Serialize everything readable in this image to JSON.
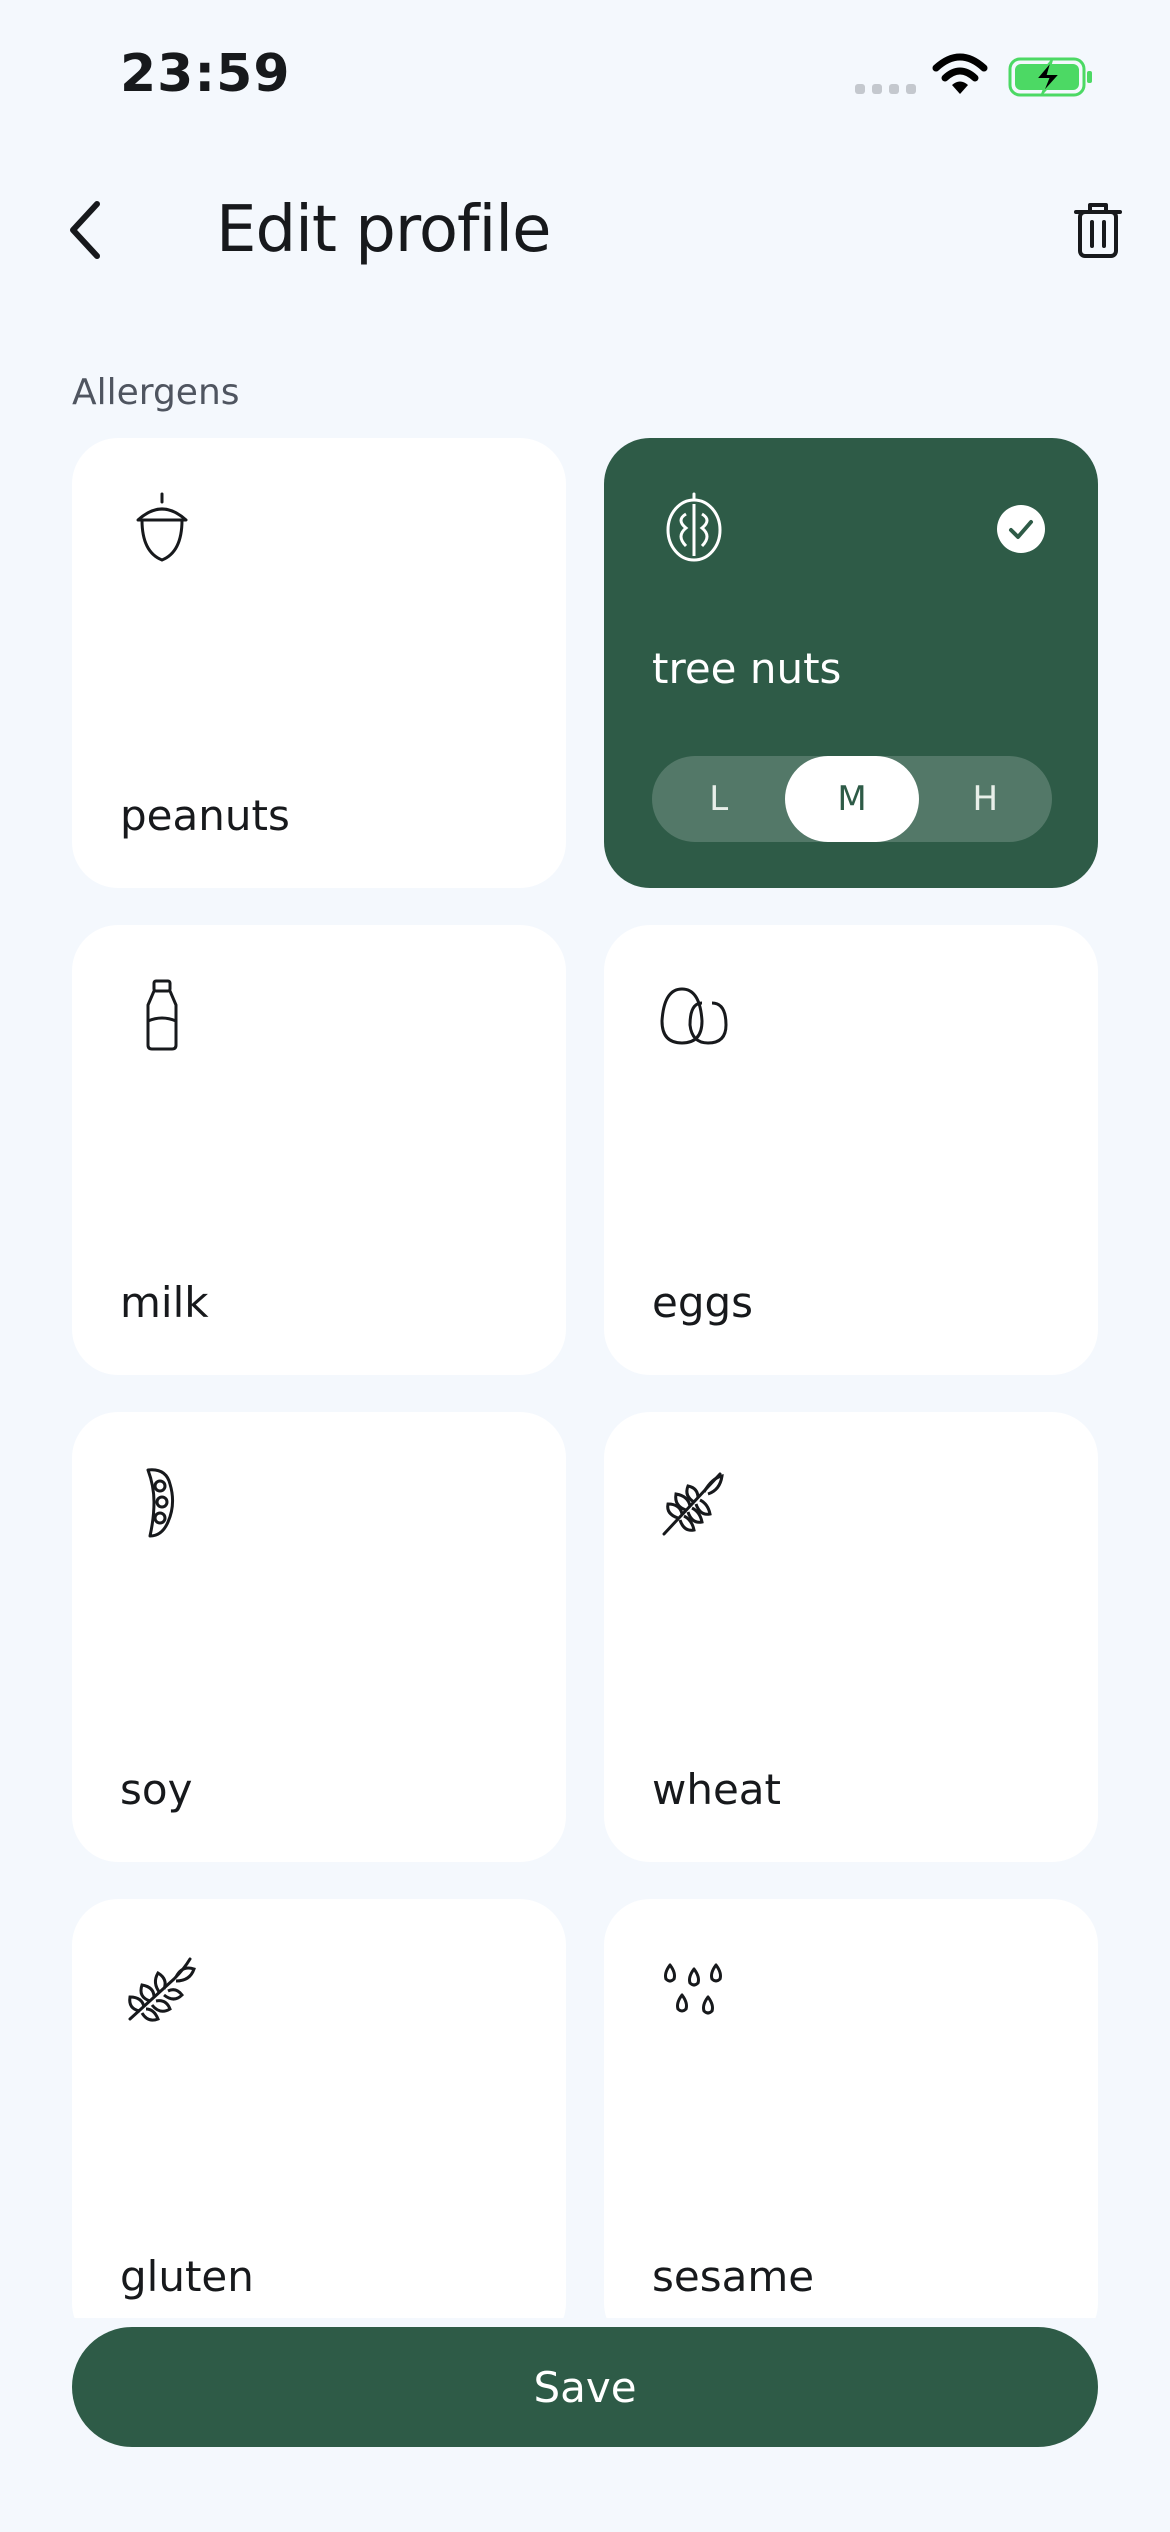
{
  "status_bar": {
    "time": "23:59"
  },
  "header": {
    "title": "Edit profile"
  },
  "section": {
    "label": "Allergens"
  },
  "allergens": [
    {
      "label": "peanuts",
      "icon": "acorn-icon",
      "selected": false
    },
    {
      "label": "tree nuts",
      "icon": "walnut-icon",
      "selected": true,
      "severity": "M"
    },
    {
      "label": "milk",
      "icon": "milk-bottle-icon",
      "selected": false
    },
    {
      "label": "eggs",
      "icon": "eggs-icon",
      "selected": false
    },
    {
      "label": "soy",
      "icon": "soybean-icon",
      "selected": false
    },
    {
      "label": "wheat",
      "icon": "wheat-icon",
      "selected": false
    },
    {
      "label": "gluten",
      "icon": "grain-icon",
      "selected": false
    },
    {
      "label": "sesame",
      "icon": "sesame-seeds-icon",
      "selected": false
    }
  ],
  "severity_options": [
    "L",
    "M",
    "H"
  ],
  "save_label": "Save",
  "colors": {
    "background": "#f4f8fd",
    "accent": "#2e5b47",
    "card": "#ffffff",
    "battery": "#4cd964"
  }
}
